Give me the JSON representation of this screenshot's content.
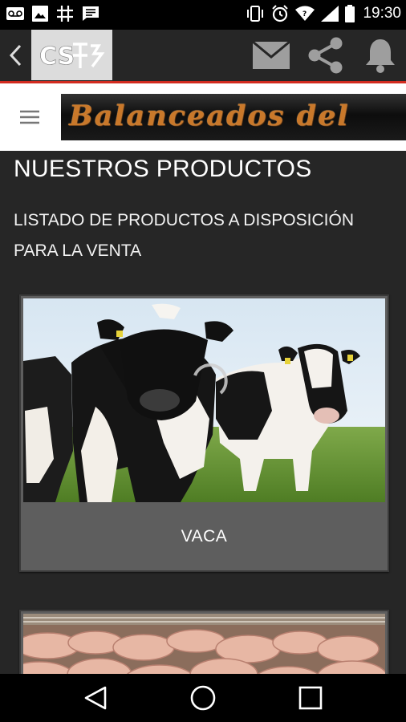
{
  "status_bar": {
    "time": "19:30",
    "left_icons": [
      "voicemail-icon",
      "image-icon",
      "grid-app-icon",
      "message-icon"
    ],
    "right_icons": [
      "vibrate-icon",
      "alarm-icon",
      "wifi-icon",
      "signal-icon",
      "battery-icon"
    ]
  },
  "toolbar": {
    "logo_text": "CS",
    "actions": [
      "mail-icon",
      "share-icon",
      "bell-icon"
    ]
  },
  "banner": {
    "text": "Balanceados del"
  },
  "content": {
    "title": "NUESTROS PRODUCTOS",
    "subtitle": "LISTADO DE PRODUCTOS A DISPOSICIÓN PARA LA VENTA",
    "products": [
      {
        "label": "VACA"
      },
      {
        "label": ""
      }
    ]
  },
  "colors": {
    "background": "#262626",
    "accent_line": "#d22b1f",
    "card": "#5e5e5e",
    "banner_text": "#c9782a"
  }
}
